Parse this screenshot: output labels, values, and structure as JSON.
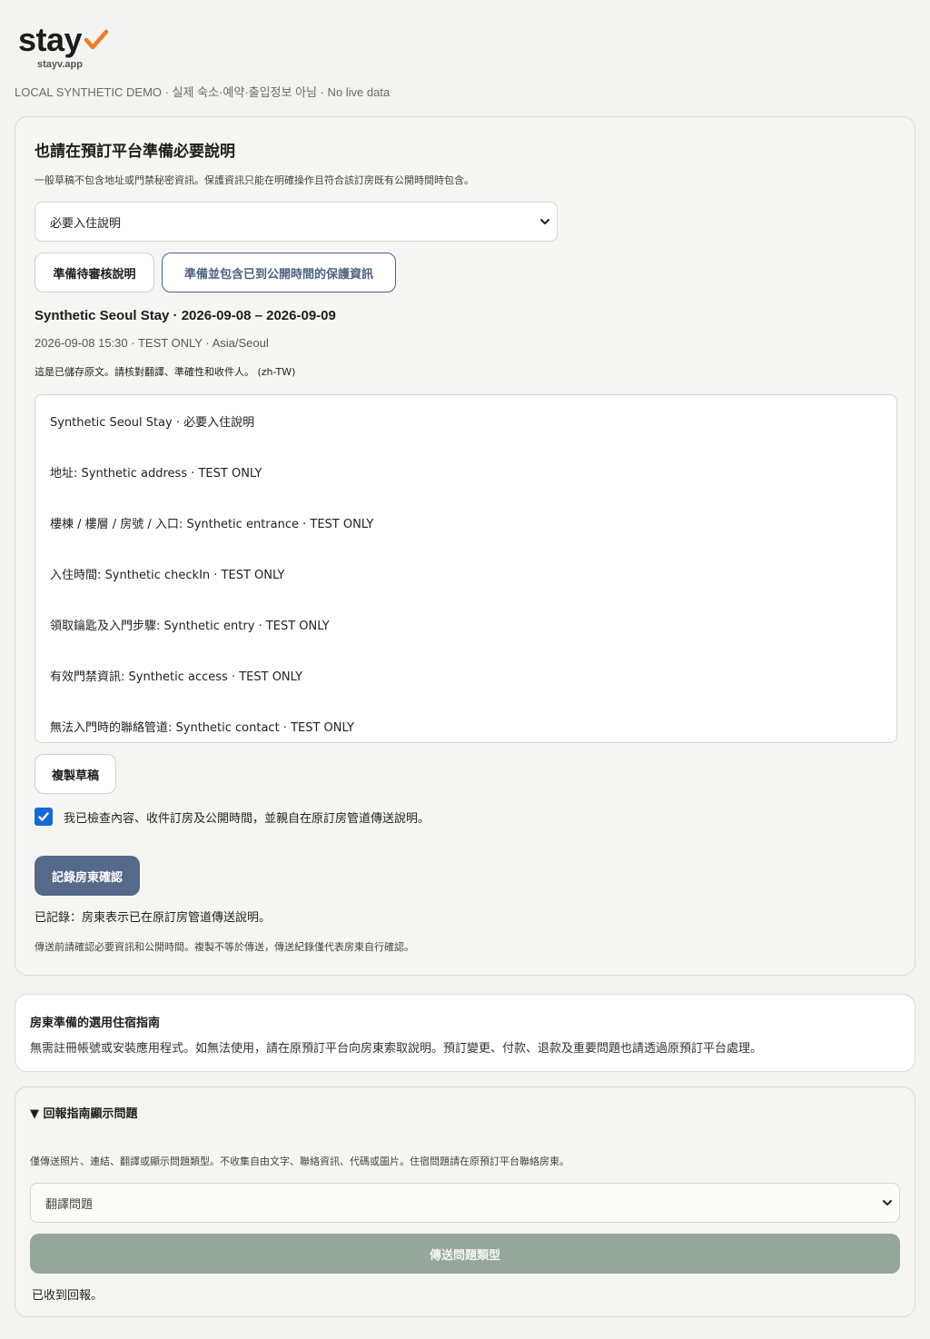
{
  "brand": {
    "name": "stay",
    "url": "stayv.app",
    "accent_color": "#f07e22"
  },
  "demo_note": "LOCAL SYNTHETIC DEMO · 실제 숙소·예약·출입정보 아님 · No live data",
  "instructions_card": {
    "title": "也請在預訂平台準備必要說明",
    "note": "一般草稿不包含地址或門禁秘密資訊。保護資訊只能在明確操作且符合該訂房既有公開時間時包含。",
    "select_value": "必要入住說明",
    "btn_review": "準備待審核說明",
    "btn_protected": "準備並包含已到公開時間的保護資訊",
    "stay_heading": "Synthetic Seoul Stay · 2026-09-08 – 2026-09-09",
    "stay_meta": "2026-09-08 15:30 · TEST ONLY · Asia/Seoul",
    "saved_note": "這是已儲存原文。請核對翻譯、準確性和收件人。 (zh-TW)",
    "draft_lines": [
      "Synthetic Seoul Stay · 必要入住說明",
      "地址: Synthetic address · TEST ONLY",
      "樓棟 / 樓層 / 房號 / 入口: Synthetic entrance · TEST ONLY",
      "入住時間: Synthetic checkIn · TEST ONLY",
      "領取鑰匙及入門步驟: Synthetic entry · TEST ONLY",
      "有效門禁資訊: Synthetic access · TEST ONLY",
      "無法入門時的聯絡管道: Synthetic contact · TEST ONLY"
    ],
    "btn_copy": "複製草稿",
    "checkbox_label": "我已檢查內容、收件訂房及公開時間，並親自在原訂房管道傳送說明。",
    "checkbox_checked": true,
    "btn_confirm": "記錄房東確認",
    "recorded_text": "已記錄：房東表示已在原訂房管道傳送說明。",
    "bottom_note": "傳送前請確認必要資訊和公開時間。複製不等於傳送，傳送紀錄僅代表房東自行確認。"
  },
  "guide_card": {
    "title": "房東準備的選用住宿指南",
    "text": "無需註冊帳號或安裝應用程式。如無法使用，請在原預訂平台向房東索取說明。預訂變更、付款、退款及重要問題也請透過原預訂平台處理。"
  },
  "report_card": {
    "toggle_label": "▼ 回報指南顯示問題",
    "note": "僅傳送照片、連結、翻譯或顯示問題類型。不收集自由文字、聯絡資訊、代碼或圖片。住宿問題請在原預訂平台聯絡房東。",
    "select_value": "翻譯問題",
    "btn_send": "傳送問題類型",
    "received_text": "已收到回報。"
  }
}
